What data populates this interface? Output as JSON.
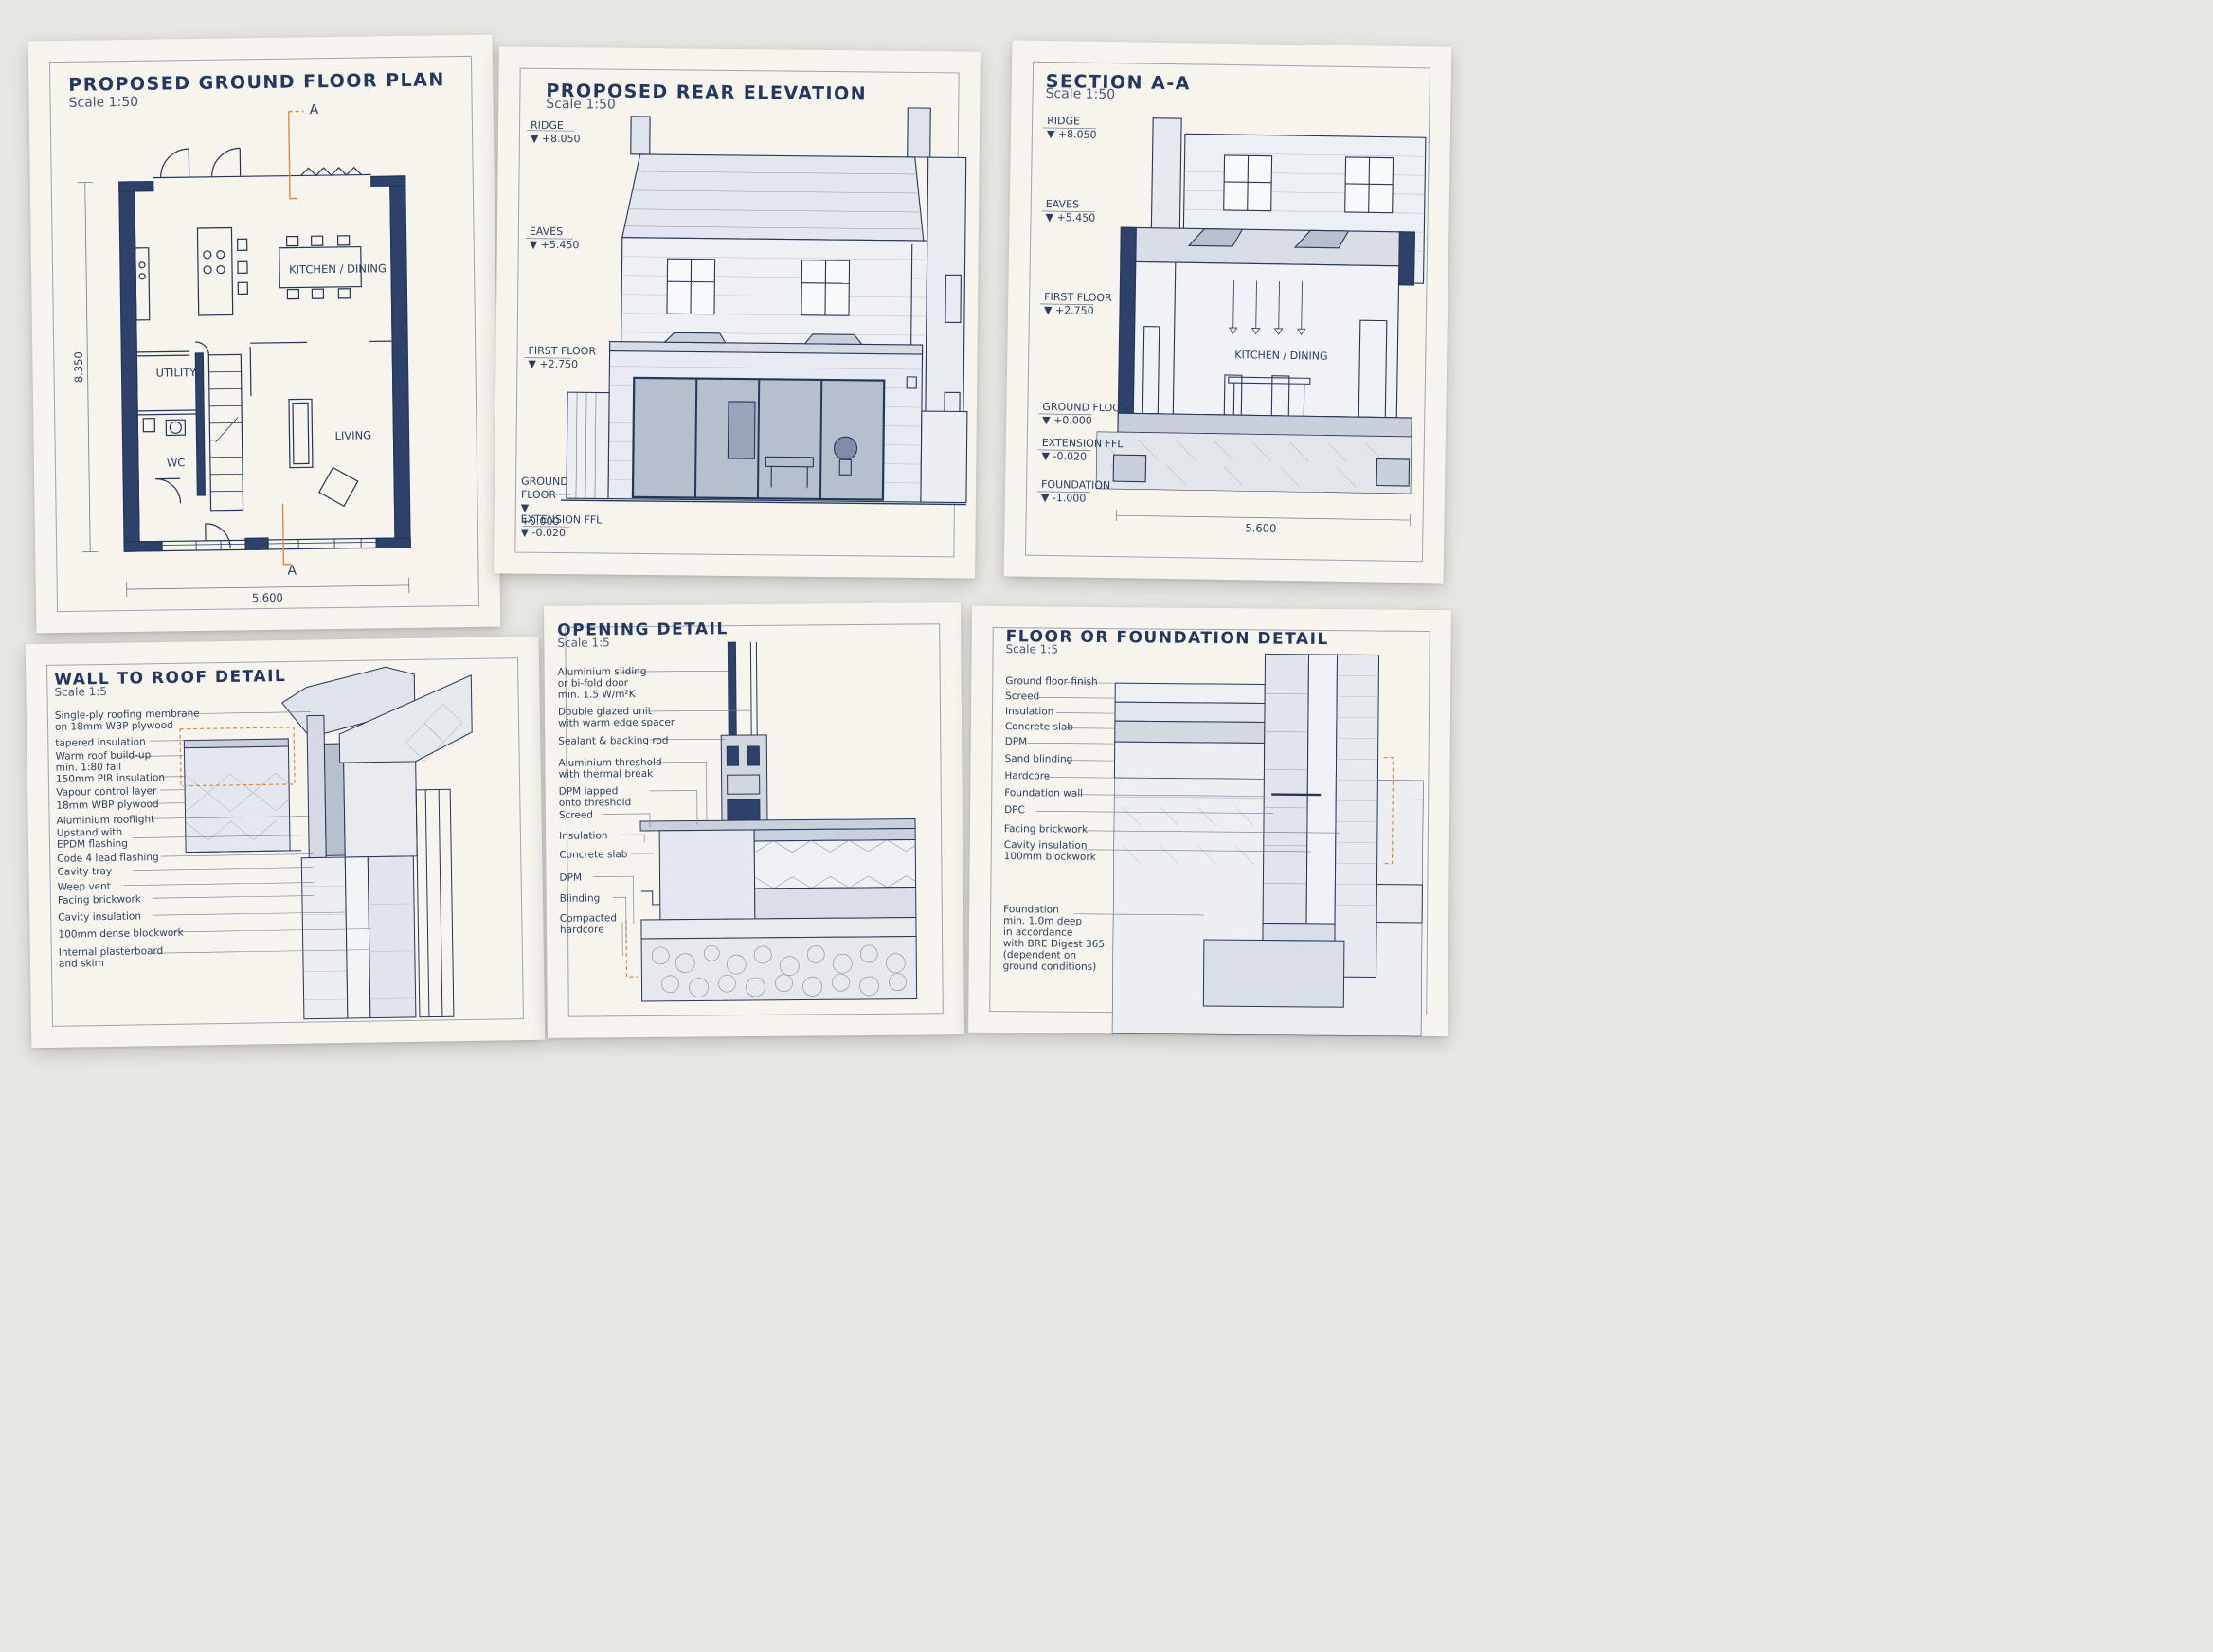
{
  "sheets": {
    "plan": {
      "title": "PROPOSED GROUND FLOOR PLAN",
      "scale": "Scale 1:50",
      "rooms": {
        "kitchen": "KITCHEN / DINING",
        "utility": "UTILITY",
        "wc": "WC",
        "living": "LIVING"
      },
      "section_marker": "A",
      "dims": {
        "width": "5.600",
        "depth": "8.350"
      }
    },
    "elevation": {
      "title": "PROPOSED REAR ELEVATION",
      "scale": "Scale 1:50",
      "levels": [
        {
          "name": "RIDGE",
          "value": "+8.050"
        },
        {
          "name": "EAVES",
          "value": "+5.450"
        },
        {
          "name": "FIRST FLOOR",
          "value": "+2.750"
        },
        {
          "name": "GROUND FLOOR",
          "value": "+0.000"
        },
        {
          "name": "EXTENSION FFL",
          "value": "-0.020"
        }
      ]
    },
    "section": {
      "title": "SECTION A-A",
      "scale": "Scale 1:50",
      "room": "KITCHEN / DINING",
      "levels": [
        {
          "name": "RIDGE",
          "value": "+8.050"
        },
        {
          "name": "EAVES",
          "value": "+5.450"
        },
        {
          "name": "FIRST FLOOR",
          "value": "+2.750"
        },
        {
          "name": "GROUND FLOOR",
          "value": "+0.000"
        },
        {
          "name": "EXTENSION FFL",
          "value": "-0.020"
        },
        {
          "name": "FOUNDATION",
          "value": "-1.000"
        }
      ],
      "dim": "5.600"
    },
    "wallroof": {
      "title": "WALL TO ROOF DETAIL",
      "scale": "Scale 1:5",
      "labels": [
        "Single-ply roofing membrane\non 18mm WBP plywood",
        "tapered insulation",
        "Warm roof build-up\nmin. 1:80 fall",
        "150mm PIR insulation",
        "Vapour control layer",
        "18mm WBP plywood",
        "Aluminium rooflight",
        "Upstand with\nEPDM flashing",
        "Code 4 lead flashing",
        "Cavity tray",
        "Weep vent",
        "Facing brickwork",
        "Cavity insulation",
        "100mm dense blockwork",
        "Internal plasterboard\nand skim"
      ]
    },
    "opening": {
      "title": "OPENING DETAIL",
      "scale": "Scale 1:5",
      "labels": [
        "Aluminium sliding\nor bi-fold door\nmin. 1.5 W/m²K",
        "Double glazed unit\nwith warm edge spacer",
        "Sealant & backing rod",
        "Aluminium threshold\nwith thermal break",
        "DPM lapped\nonto threshold",
        "Screed",
        "Insulation",
        "Concrete slab",
        "DPM",
        "Blinding",
        "Compacted\nhardcore"
      ]
    },
    "foundation": {
      "title": "FLOOR OR FOUNDATION DETAIL",
      "scale": "Scale 1:5",
      "labels": [
        "Ground floor finish",
        "Screed",
        "Insulation",
        "Concrete slab",
        "DPM",
        "Sand blinding",
        "Hardcore",
        "Foundation wall",
        "DPC",
        "Facing brickwork",
        "Cavity insulation\n100mm blockwork",
        "Foundation\nmin. 1.0m deep\nin accordance\nwith BRE Digest 365\n(dependent on\nground conditions)"
      ]
    }
  },
  "colors": {
    "ink": "#23375a",
    "accent": "#e08a3c",
    "paper": "#f6f4ec",
    "backdrop": "#e7e6e1"
  }
}
